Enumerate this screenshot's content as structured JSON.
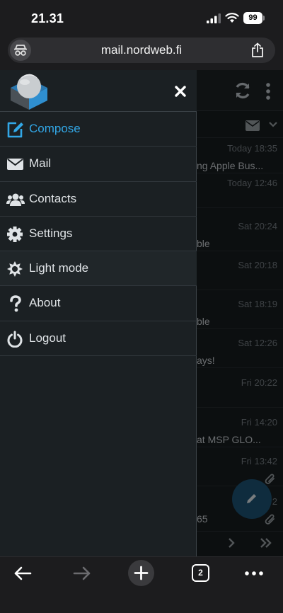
{
  "status_bar": {
    "time": "21.31",
    "battery": "99"
  },
  "browser": {
    "url": "mail.nordweb.fi",
    "open_tabs": "2"
  },
  "drawer": {
    "items": [
      {
        "label": "Compose",
        "icon": "compose-icon",
        "active": true
      },
      {
        "label": "Mail",
        "icon": "envelope-icon"
      },
      {
        "label": "Contacts",
        "icon": "users-icon"
      },
      {
        "label": "Settings",
        "icon": "gear-icon"
      },
      {
        "label": "Light mode",
        "icon": "sun-icon"
      },
      {
        "label": "About",
        "icon": "question-icon"
      },
      {
        "label": "Logout",
        "icon": "power-icon"
      }
    ]
  },
  "message_list": {
    "rows": [
      {
        "date": "Today 18:35",
        "subject": "ng Apple Bus..."
      },
      {
        "date": "Today 12:46",
        "subject": ""
      },
      {
        "date": "Sat 20:24",
        "subject": "ble"
      },
      {
        "date": "Sat 20:18",
        "subject": ""
      },
      {
        "date": "Sat 18:19",
        "subject": "ble"
      },
      {
        "date": "Sat 12:26",
        "subject": "ays!"
      },
      {
        "date": "Fri 20:22",
        "subject": ""
      },
      {
        "date": "Fri 14:20",
        "subject": "at MSP GLO..."
      },
      {
        "date": "Fri 13:42",
        "subject": ""
      },
      {
        "date": "2",
        "subject": "65"
      }
    ]
  },
  "colors": {
    "accent": "#32a7e6",
    "drawer_bg": "#1b2023",
    "app_bg": "#161a1d"
  }
}
